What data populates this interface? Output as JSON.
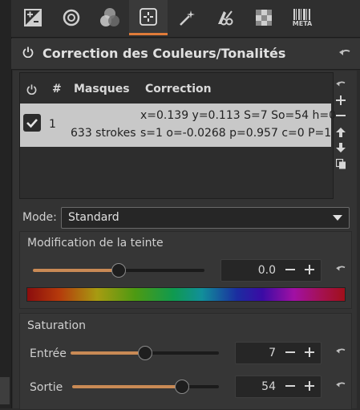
{
  "toolbar": {
    "tabs": [
      {
        "icon": "exposure-icon",
        "active": false
      },
      {
        "icon": "detail-icon",
        "active": false
      },
      {
        "icon": "color-icon",
        "active": false
      },
      {
        "icon": "local-adjustments-icon",
        "active": true
      },
      {
        "icon": "magic-wand-icon",
        "active": false
      },
      {
        "icon": "transform-icon",
        "active": false
      },
      {
        "icon": "raw-icon",
        "active": false
      },
      {
        "icon": "metadata-icon",
        "active": false
      }
    ],
    "meta_label": "META"
  },
  "section": {
    "title": "Correction des Couleurs/Tonalités"
  },
  "masks": {
    "headers": {
      "hash": "#",
      "masks": "Masques",
      "correction": "Correction"
    },
    "rows": [
      {
        "enabled": true,
        "index": "1",
        "mask": "633 strokes",
        "correction_line1": "x=0.139 y=0.113 S=7 So=54 h=0",
        "correction_line2": "s=1 o=-0.0268 p=0.957 c=0 P=1"
      }
    ]
  },
  "mode": {
    "label": "Mode:",
    "value": "Standard"
  },
  "hue": {
    "label": "Modification de la teinte",
    "value": "0.0",
    "slider_fraction": 0.5
  },
  "saturation": {
    "label": "Saturation",
    "input": {
      "label": "Entrée",
      "value": "7",
      "slider_fraction": 0.5
    },
    "output": {
      "label": "Sortie",
      "value": "54",
      "slider_fraction": 0.75
    }
  },
  "colors": {
    "accent": "#e07b39",
    "slider_fill": "#c98a55",
    "selected_row": "#c8c8c8"
  }
}
